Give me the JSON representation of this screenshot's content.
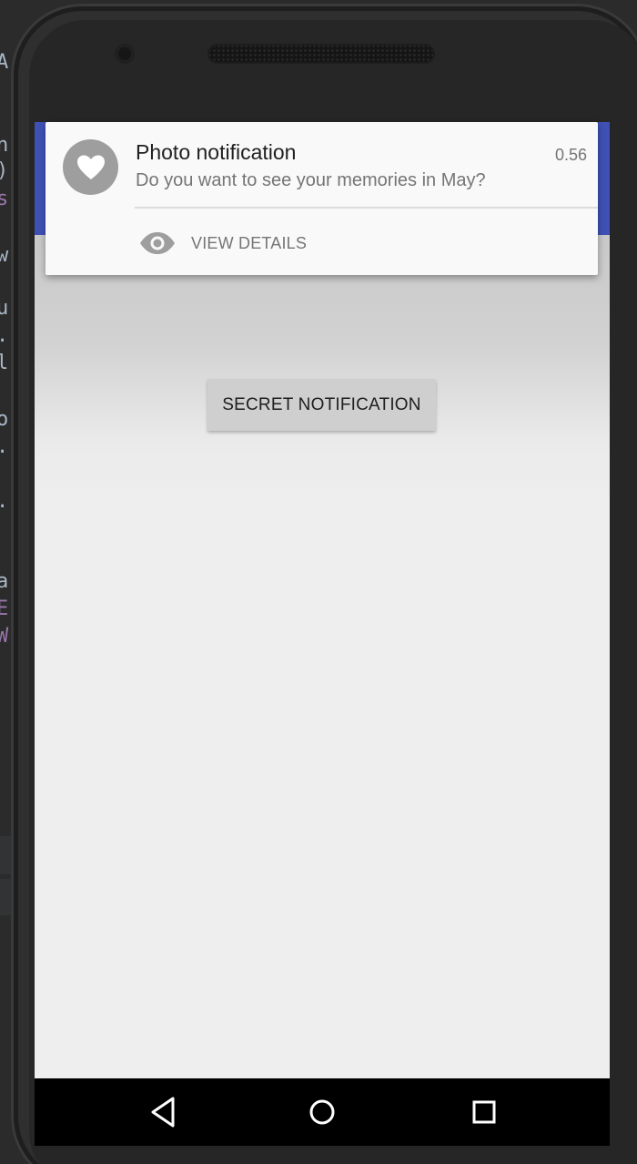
{
  "editor": {
    "glyphs": [
      {
        "text": "A",
        "purple": false
      },
      {
        "text": "n",
        "purple": false
      },
      {
        "text": ")",
        "purple": false
      },
      {
        "text": "s",
        "purple": true
      },
      {
        "text": "w",
        "purple": false
      },
      {
        "text": "u",
        "purple": false
      },
      {
        "text": ".",
        "purple": false
      },
      {
        "text": "l",
        "purple": false
      },
      {
        "text": "o",
        "purple": false
      },
      {
        "text": ".",
        "purple": false
      },
      {
        "text": ".",
        "purple": false
      },
      {
        "text": "a",
        "purple": false
      },
      {
        "text": "E",
        "purple": true
      },
      {
        "text": "W",
        "purple": true
      }
    ]
  },
  "app": {
    "secret_button_label": "SECRET NOTIFICATION"
  },
  "notification": {
    "icon": "heart-icon",
    "title": "Photo notification",
    "time": "0.56",
    "text": "Do you want to see your memories in May?",
    "action_icon": "eye-icon",
    "action_label": "VIEW DETAILS"
  },
  "nav": {
    "back_icon": "back-triangle-icon",
    "home_icon": "home-circle-icon",
    "recents_icon": "recents-square-icon"
  },
  "colors": {
    "app_bar": "#3f51b5",
    "background": "#eeeeee",
    "notification_bg": "#f9f9f9"
  }
}
